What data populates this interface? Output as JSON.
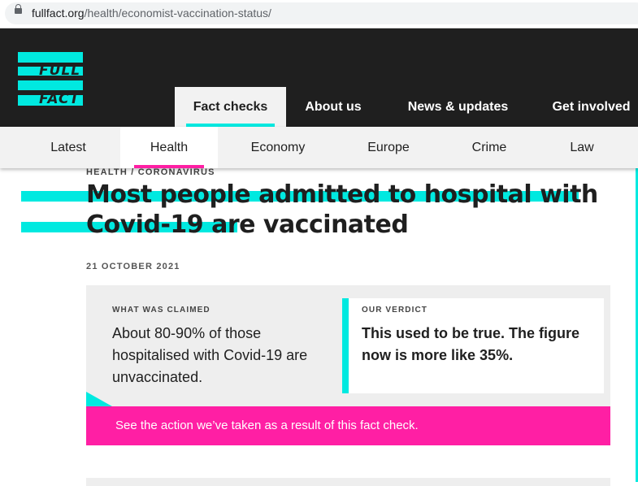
{
  "browser": {
    "url_domain": "fullfact.org",
    "url_path": "/health/economist-vaccination-status/"
  },
  "logo": {
    "line1": "FULL",
    "line2": "FACT"
  },
  "main_nav": [
    {
      "label": "Fact checks",
      "active": true
    },
    {
      "label": "About us"
    },
    {
      "label": "News & updates"
    },
    {
      "label": "Get involved"
    }
  ],
  "sub_nav": [
    {
      "label": "Latest"
    },
    {
      "label": "Health",
      "active": true
    },
    {
      "label": "Economy"
    },
    {
      "label": "Europe"
    },
    {
      "label": "Crime"
    },
    {
      "label": "Law"
    }
  ],
  "article": {
    "breadcrumb": "HEALTH / CORONAVIRUS",
    "title": "Most people admitted to hospital with Covid-19 are vaccinated",
    "date": "21 OCTOBER 2021",
    "claim_label": "WHAT WAS CLAIMED",
    "claim": "About 80-90% of those hospitalised with Covid-19 are unvaccinated.",
    "verdict_label": "OUR VERDICT",
    "verdict": "This used to be true. The figure now is more like 35%.",
    "action_link": "See the action we’ve taken as a result of this fact check."
  },
  "colors": {
    "accent_cyan": "#00e9e0",
    "accent_pink": "#ff1fa4",
    "header_bg": "#1f1f1f"
  }
}
